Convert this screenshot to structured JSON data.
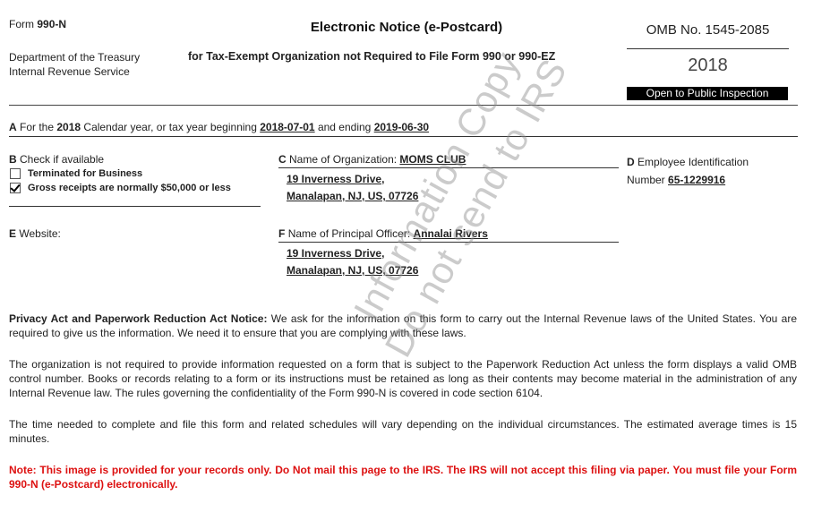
{
  "header": {
    "form_prefix": "Form",
    "form_number": "990-N",
    "title": "Electronic Notice (e-Postcard)",
    "dept_line1": "Department of the Treasury",
    "dept_line2": "Internal Revenue Service",
    "subtitle": "for Tax-Exempt Organization not Required to File Form 990 or 990-EZ",
    "omb": "OMB No. 1545-2085",
    "year": "2018",
    "public_inspection": "Open to Public Inspection"
  },
  "section_a": {
    "letter": "A",
    "text1": "For the",
    "year": "2018",
    "text2": "Calendar year, or tax year beginning",
    "begin": "2018-07-01",
    "text3": "and ending",
    "end": "2019-06-30"
  },
  "section_b": {
    "letter": "B",
    "label": "Check if available",
    "options": [
      {
        "label": "Terminated for Business",
        "checked": false
      },
      {
        "label": "Gross receipts are normally $50,000 or less",
        "checked": true
      }
    ]
  },
  "section_c": {
    "letter": "C",
    "label": "Name of Organization:",
    "name": "MOMS CLUB",
    "address1": "19 Inverness Drive,",
    "address2": "Manalapan, NJ, US, 07726"
  },
  "section_d": {
    "letter": "D",
    "label1": "Employee Identification",
    "label2": "Number",
    "ein": "65-1229916"
  },
  "section_e": {
    "letter": "E",
    "label": "Website:"
  },
  "section_f": {
    "letter": "F",
    "label": "Name of Principal Officer:",
    "name": "Annalai Rivers",
    "address1": "19 Inverness Drive,",
    "address2": "Manalapan, NJ, US, 07726"
  },
  "paragraphs": {
    "privacy_heading": "Privacy Act and Paperwork Reduction Act Notice:",
    "privacy_body": " We ask for the information on this form to carry out the Internal Revenue laws of the United States. You are required to give us the information. We need it to ensure that you are complying with these laws.",
    "omb_notice": "The organization is not required to provide information requested on a form that is subject to the Paperwork Reduction Act unless the form displays a valid OMB control number. Books or records relating to a form or its instructions must be retained as long as their contents may become material in the administration of any Internal Revenue law. The rules governing the confidentiality of the Form 990-N is covered in code section 6104.",
    "time_notice": "The time needed to complete and file this form and related schedules will vary depending on the individual circumstances. The estimated average times is 15 minutes.",
    "note": "Note: This image is provided for your records only. Do Not mail this page to the IRS. The IRS will not accept this filing via paper. You must file your Form 990-N (e-Postcard) electronically."
  },
  "watermark": {
    "line1": "Information Copy",
    "line2": "Do not send to IRS"
  }
}
